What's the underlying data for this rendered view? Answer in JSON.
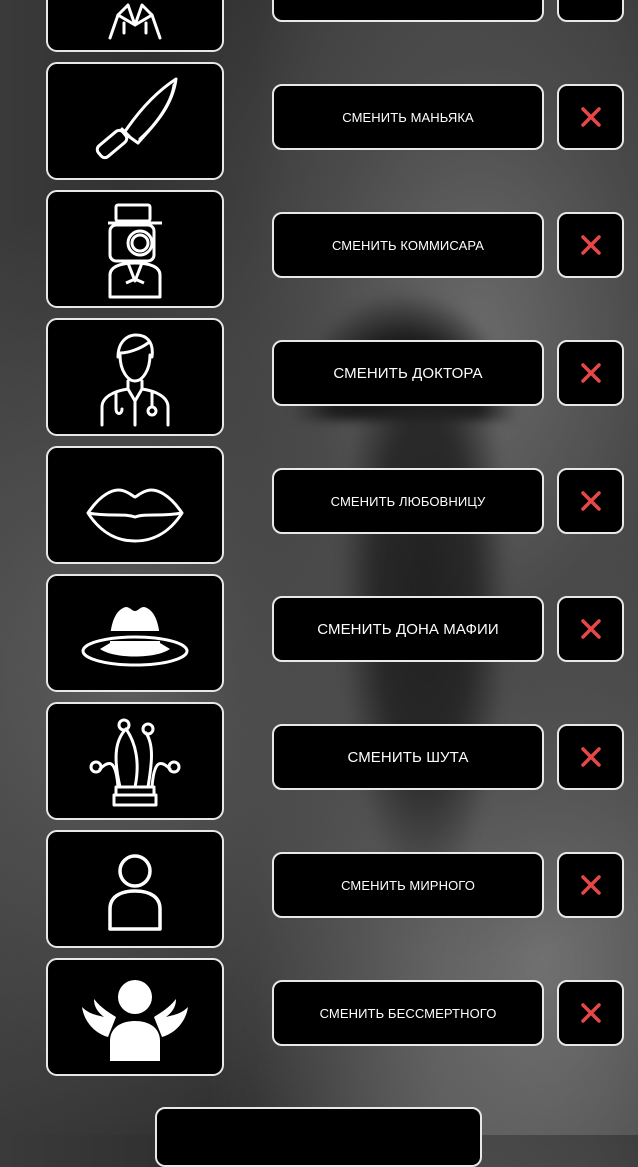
{
  "colors": {
    "accent_delete": "#e8474a",
    "tile_bg": "#000000",
    "border": "#e8e8e8"
  },
  "roles": [
    {
      "icon": "suit-person-icon",
      "button_label": ""
    },
    {
      "icon": "knife-icon",
      "button_label": "СМЕНИТЬ МАНЬЯКА"
    },
    {
      "icon": "detective-magnifier-icon",
      "button_label": "СМЕНИТЬ КОММИСАРА"
    },
    {
      "icon": "doctor-icon",
      "button_label": "СМЕНИТЬ ДОКТОРА"
    },
    {
      "icon": "lips-icon",
      "button_label": "СМЕНИТЬ ЛЮБОВНИЦУ"
    },
    {
      "icon": "fedora-hat-icon",
      "button_label": "СМЕНИТЬ ДОНА МАФИИ"
    },
    {
      "icon": "jester-hat-icon",
      "button_label": "СМЕНИТЬ ШУТА"
    },
    {
      "icon": "civilian-person-icon",
      "button_label": "СМЕНИТЬ МИРНОГО"
    },
    {
      "icon": "winged-person-icon",
      "button_label": "СМЕНИТЬ БЕССМЕРТНОГО"
    }
  ],
  "delete_icon": "close-icon"
}
